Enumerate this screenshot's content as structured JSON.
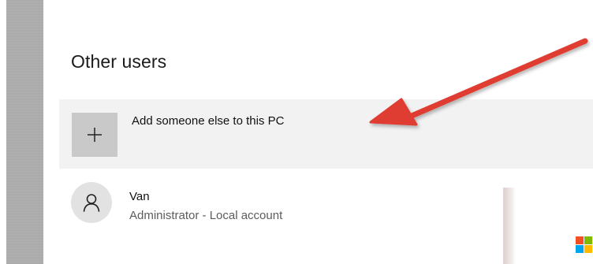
{
  "section": {
    "title": "Other users"
  },
  "add_user": {
    "label": "Add someone else to this PC",
    "icon": "plus-icon"
  },
  "users": [
    {
      "name": "Van",
      "subtitle": "Administrator - Local account",
      "icon": "person-icon"
    }
  ],
  "annotation": {
    "arrow_color": "#e03c31",
    "target": "add-someone-else-button"
  },
  "colors": {
    "add_row_background": "#f2f2f2",
    "icon_box": "#c9c9c9",
    "avatar_background": "#e2e2e2",
    "sidebar_bar": "#aeaeae"
  },
  "logo": {
    "name": "windows-logo",
    "colors": [
      "#f25022",
      "#7fba00",
      "#00a4ef",
      "#ffb900"
    ]
  }
}
